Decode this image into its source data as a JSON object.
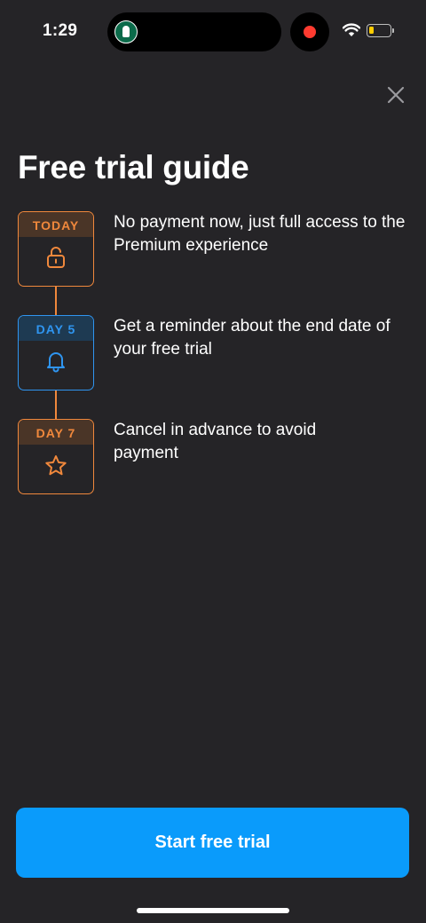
{
  "status_bar": {
    "time": "1:29",
    "island_app_icon": "starbucks-logo",
    "recording_color": "#ff3b30",
    "battery_color": "#ffcc00"
  },
  "close_icon": "close-x-icon",
  "title": "Free trial guide",
  "steps": [
    {
      "badge": "TODAY",
      "icon": "unlock-icon",
      "color": "#f0883c",
      "text": "No payment now, just full access to the Premium experience"
    },
    {
      "badge": "DAY 5",
      "icon": "bell-icon",
      "color": "#2f95f0",
      "text": "Get a reminder about the end date of your free trial"
    },
    {
      "badge": "DAY 7",
      "icon": "star-icon",
      "color": "#f0883c",
      "text": "Cancel in advance to avoid payment"
    }
  ],
  "cta": {
    "label": "Start free trial",
    "color": "#0a9bfb"
  },
  "colors": {
    "background": "#252427",
    "accent_orange": "#f0883c",
    "accent_blue": "#2f95f0"
  }
}
